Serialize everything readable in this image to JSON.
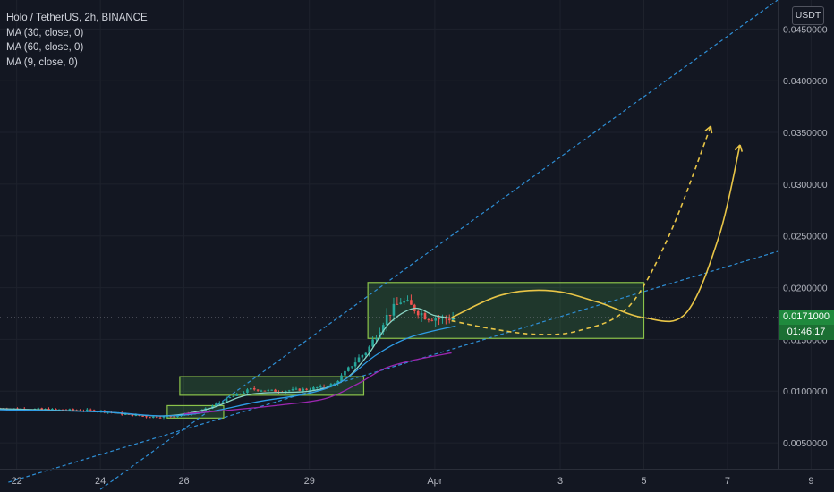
{
  "header": {
    "title": "Holo / TetherUS, 2h, BINANCE",
    "indicators": [
      "MA (30, close, 0)",
      "MA (60, close, 0)",
      "MA (9, close, 0)"
    ],
    "currency": "USDT"
  },
  "price_label": {
    "value": "0.0171000",
    "countdown": "01:46:17"
  },
  "colors": {
    "background": "#131722",
    "grid": "#1e222d",
    "up": "#26a69a",
    "down": "#ef5350",
    "ma30": "#8bd4c4",
    "ma60": "#2e9ce6",
    "ma9": "#9c27b0",
    "trendline": "#2e8fd6",
    "projection": "#e8c547",
    "zone_fill": "#4caf50",
    "zone_stroke": "#8bc34a",
    "price_label_bg": "#1f8a3d"
  },
  "chart_data": {
    "type": "candlestick",
    "title": "Holo / TetherUS, 2h, BINANCE",
    "x_ticks": [
      "22",
      "24",
      "26",
      "29",
      "Apr",
      "3",
      "5",
      "7",
      "9"
    ],
    "y_ticks": [
      "0.0050000",
      "0.0100000",
      "0.0150000",
      "0.0200000",
      "0.0250000",
      "0.0300000",
      "0.0350000",
      "0.0400000",
      "0.0450000"
    ],
    "ylim": [
      0.0025,
      0.0478
    ],
    "xlim": [
      21.6,
      40.2
    ],
    "x_tick_positions": [
      22,
      24,
      26,
      29,
      32,
      35,
      37,
      39,
      41
    ],
    "current_price": 0.0171,
    "ohlc_key_points": [
      [
        21.6,
        0.0083
      ],
      [
        22.0,
        0.0083
      ],
      [
        23.0,
        0.0082
      ],
      [
        24.0,
        0.0081
      ],
      [
        24.5,
        0.0078
      ],
      [
        25.2,
        0.0075
      ],
      [
        25.8,
        0.0076
      ],
      [
        26.4,
        0.008
      ],
      [
        27.0,
        0.0092
      ],
      [
        27.6,
        0.0102
      ],
      [
        28.2,
        0.01
      ],
      [
        29.0,
        0.0102
      ],
      [
        29.6,
        0.0107
      ],
      [
        30.0,
        0.0125
      ],
      [
        30.4,
        0.014
      ],
      [
        30.8,
        0.017
      ],
      [
        31.2,
        0.0188
      ],
      [
        31.5,
        0.018
      ],
      [
        31.8,
        0.0172
      ],
      [
        32.2,
        0.017
      ],
      [
        32.5,
        0.0171
      ]
    ],
    "moving_averages": [
      {
        "name": "MA (30, close, 0)",
        "color": "#8bd4c4",
        "points": [
          [
            21.6,
            0.0083
          ],
          [
            24.0,
            0.008
          ],
          [
            25.5,
            0.0076
          ],
          [
            26.6,
            0.0083
          ],
          [
            27.6,
            0.0097
          ],
          [
            29.0,
            0.01
          ],
          [
            29.8,
            0.011
          ],
          [
            30.4,
            0.0135
          ],
          [
            30.9,
            0.0165
          ],
          [
            31.5,
            0.018
          ],
          [
            32.0,
            0.0173
          ],
          [
            32.5,
            0.017
          ]
        ]
      },
      {
        "name": "MA (60, close, 0)",
        "color": "#2e9ce6",
        "points": [
          [
            21.6,
            0.0082
          ],
          [
            24.0,
            0.008
          ],
          [
            25.5,
            0.0076
          ],
          [
            26.6,
            0.008
          ],
          [
            27.8,
            0.009
          ],
          [
            29.0,
            0.0098
          ],
          [
            29.8,
            0.011
          ],
          [
            30.6,
            0.0135
          ],
          [
            31.4,
            0.0152
          ],
          [
            32.5,
            0.0163
          ]
        ]
      },
      {
        "name": "MA (9, close, 0)",
        "color": "#9c27b0",
        "points": [
          [
            26.0,
            0.0078
          ],
          [
            27.2,
            0.0082
          ],
          [
            28.4,
            0.0087
          ],
          [
            29.4,
            0.0093
          ],
          [
            30.2,
            0.0108
          ],
          [
            30.8,
            0.0122
          ],
          [
            31.5,
            0.013
          ],
          [
            32.4,
            0.0137
          ]
        ]
      }
    ],
    "annotations": {
      "trendlines": [
        {
          "style": "dashed",
          "from": [
            24.0,
            0.0005
          ],
          "to": [
            40.2,
            0.0478
          ]
        },
        {
          "style": "dashed",
          "from": [
            21.8,
            0.0012
          ],
          "to": [
            40.2,
            0.0235
          ]
        }
      ],
      "zones": [
        {
          "x": [
            25.6,
            26.95
          ],
          "y": [
            0.0074,
            0.0086
          ]
        },
        {
          "x": [
            25.9,
            30.3
          ],
          "y": [
            0.0096,
            0.0114
          ]
        },
        {
          "x": [
            30.4,
            37.0
          ],
          "y": [
            0.0151,
            0.0205
          ]
        }
      ],
      "projections": [
        {
          "style": "solid",
          "points": [
            [
              32.4,
              0.0171
            ],
            [
              33.6,
              0.0193
            ],
            [
              34.8,
              0.0197
            ],
            [
              35.9,
              0.0186
            ],
            [
              37.0,
              0.0171
            ],
            [
              38.0,
              0.0175
            ],
            [
              38.8,
              0.025
            ],
            [
              39.3,
              0.0338
            ]
          ]
        },
        {
          "style": "dashed",
          "points": [
            [
              32.4,
              0.0168
            ],
            [
              33.4,
              0.016
            ],
            [
              34.4,
              0.0155
            ],
            [
              35.4,
              0.0158
            ],
            [
              36.6,
              0.018
            ],
            [
              37.6,
              0.025
            ],
            [
              38.6,
              0.0356
            ]
          ]
        }
      ]
    }
  }
}
